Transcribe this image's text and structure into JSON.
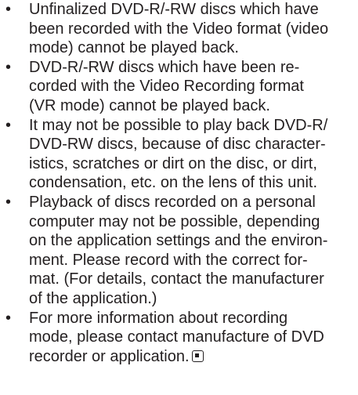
{
  "bullet_glyph": "•",
  "items": [
    {
      "lines": [
        "Unfinalized DVD-R/-RW discs which have",
        "been recorded with the Video format (video",
        "mode) cannot be played back."
      ]
    },
    {
      "lines": [
        "DVD-R/-RW discs which have been re-",
        "corded with the Video Recording format",
        "(VR mode) cannot be played back."
      ]
    },
    {
      "lines": [
        "It may not be possible to play back DVD-R/",
        "DVD-RW discs, because of disc character-",
        "istics, scratches or dirt on the disc, or dirt,",
        "condensation, etc. on the lens of this unit."
      ]
    },
    {
      "lines": [
        "Playback of discs recorded on a personal",
        "computer may not be possible, depending",
        "on the application settings and the environ-",
        "ment. Please record with the correct for-",
        "mat. (For details, contact the manufacturer",
        "of the application.)"
      ]
    },
    {
      "lines": [
        "For more information about recording",
        "mode, please contact manufacture of DVD",
        "recorder or application."
      ],
      "end_mark_icon": "end-of-section-icon"
    }
  ]
}
